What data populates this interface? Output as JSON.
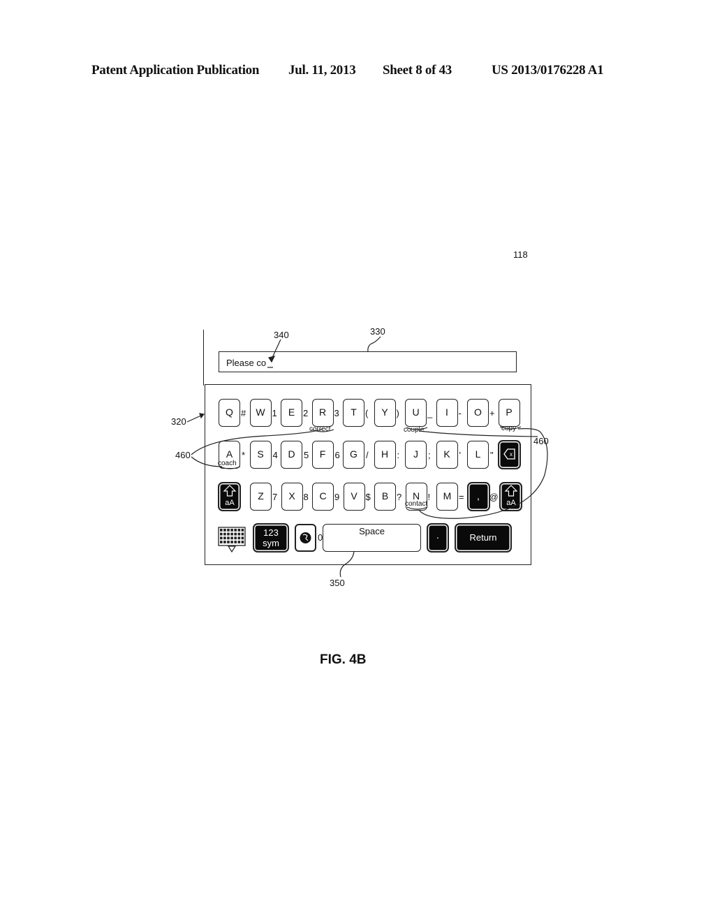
{
  "header": {
    "publication": "Patent Application Publication",
    "date": "Jul. 11, 2013",
    "sheet": "Sheet 8 of 43",
    "number": "US 2013/0176228 A1"
  },
  "refs": {
    "device": "118",
    "cursor": "340",
    "text_field": "330",
    "keyboard": "320",
    "suggestions": "460",
    "suggestions_right": "460",
    "space_key": "350"
  },
  "text_field": {
    "value": "Please co"
  },
  "keyboard": {
    "row1": [
      {
        "key": "Q",
        "sep": "#"
      },
      {
        "key": "W",
        "sep": "1"
      },
      {
        "key": "E",
        "sep": "2"
      },
      {
        "key": "R",
        "sep": "3"
      },
      {
        "key": "T",
        "sep": "("
      },
      {
        "key": "Y",
        "sep": ")"
      },
      {
        "key": "U",
        "sep": "_"
      },
      {
        "key": "I",
        "sep": "-"
      },
      {
        "key": "O",
        "sep": "+"
      },
      {
        "key": "P",
        "sep": ""
      }
    ],
    "row2": [
      {
        "key": "A",
        "sep": "*"
      },
      {
        "key": "S",
        "sep": "4"
      },
      {
        "key": "D",
        "sep": "5"
      },
      {
        "key": "F",
        "sep": "6"
      },
      {
        "key": "G",
        "sep": "/"
      },
      {
        "key": "H",
        "sep": ":"
      },
      {
        "key": "J",
        "sep": ";"
      },
      {
        "key": "K",
        "sep": "'"
      },
      {
        "key": "L",
        "sep": "\""
      }
    ],
    "row3": [
      {
        "key": "Z",
        "sep": "7"
      },
      {
        "key": "X",
        "sep": "8"
      },
      {
        "key": "C",
        "sep": "9"
      },
      {
        "key": "V",
        "sep": "$"
      },
      {
        "key": "B",
        "sep": "?"
      },
      {
        "key": "N",
        "sep": "!"
      },
      {
        "key": "M",
        "sep": "="
      }
    ],
    "comma_key": ",",
    "at_sep": "@",
    "shift_label": "aA",
    "backspace_label": "x",
    "sym_label_1": "123",
    "sym_label_2": "sym",
    "zero_sep": "0",
    "space_label": "Space",
    "period_key": "·",
    "return_label": "Return",
    "icons": [
      "keyboard-hide-icon",
      "globe-icon",
      "shift-arrow-icon",
      "backspace-icon"
    ]
  },
  "suggestions": {
    "R": "correct",
    "A": "coach",
    "U": "couple",
    "P": "copy",
    "N": "contact"
  },
  "figure_label": "FIG. 4B"
}
